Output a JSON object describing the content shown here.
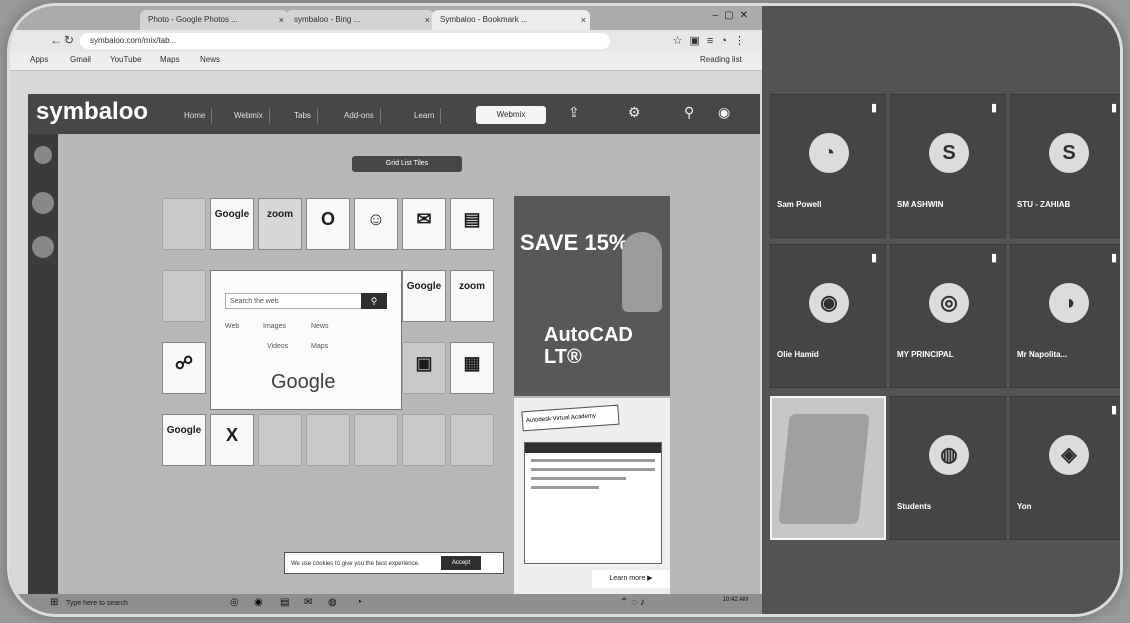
{
  "browser": {
    "tabs": [
      {
        "label": "Photo - Google Photos ..."
      },
      {
        "label": "symbaloo - Bing ..."
      },
      {
        "label": "Symbaloo - Bookmark ..."
      }
    ],
    "address": "symbaloo.com/mix/tab...",
    "bookmarks": [
      "Apps",
      "Gmail",
      "YouTube",
      "Maps",
      "News"
    ],
    "reading_list": "Reading list"
  },
  "symbaloo": {
    "logo": "symbaloo",
    "nav": [
      "Home",
      "Webmix",
      "Tabs",
      "Add-ons",
      "Learn"
    ],
    "webmix": "Webmix",
    "view_toggle": "Grid  List  Tiles",
    "tiles": [
      {
        "cap": "",
        "glyph": "Google"
      },
      {
        "cap": "",
        "glyph": "zoom"
      },
      {
        "cap": "",
        "glyph": "O"
      },
      {
        "cap": "",
        "glyph": "☺"
      },
      {
        "cap": "",
        "glyph": "✉"
      },
      {
        "cap": "",
        "glyph": "▤"
      },
      {
        "cap": "",
        "glyph": "Google"
      },
      {
        "cap": "",
        "glyph": "zoom"
      },
      {
        "cap": "",
        "glyph": "☍"
      },
      {
        "cap": "",
        "glyph": "▣"
      },
      {
        "cap": "",
        "glyph": "▦"
      },
      {
        "cap": "",
        "glyph": "Google"
      },
      {
        "cap": "",
        "glyph": "X"
      }
    ],
    "google_widget": {
      "placeholder": "Search the web",
      "options": [
        "Web",
        "Images",
        "News",
        "Videos",
        "Maps"
      ],
      "logo": "Google"
    },
    "ad": {
      "headline": "SAVE 15%",
      "product": "AutoCAD LT®"
    },
    "ad2": {
      "title": "Autodesk Virtual Academy",
      "cta": "Learn more ▶"
    },
    "cookie": {
      "text": "We use cookies to give you the best experience.",
      "accept": "Accept"
    },
    "taskbar": {
      "search": "Type here to search",
      "time": "10:42 AM"
    }
  },
  "meeting": {
    "participants": [
      {
        "name": "Sam Powell",
        "initial": "◔"
      },
      {
        "name": "SM ASHWIN",
        "initial": "S"
      },
      {
        "name": "STU - ZAHIAB",
        "initial": "S"
      },
      {
        "name": "Olie Hamid",
        "initial": "◉"
      },
      {
        "name": "MY PRINCIPAL",
        "initial": "◎"
      },
      {
        "name": "Mr Napolita...",
        "initial": "◑"
      },
      {
        "name": "",
        "initial": ""
      },
      {
        "name": "Students",
        "initial": "◍"
      },
      {
        "name": "Yon",
        "initial": "◈"
      }
    ]
  }
}
